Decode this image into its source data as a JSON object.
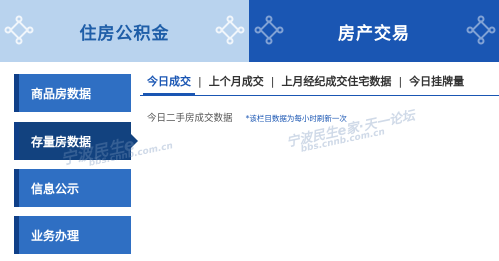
{
  "top_tabs": {
    "left_label": "住房公积金",
    "right_label": "房产交易"
  },
  "sidebar": {
    "items": [
      {
        "label": "商品房数据"
      },
      {
        "label": "存量房数据"
      },
      {
        "label": "信息公示"
      },
      {
        "label": "业务办理"
      }
    ]
  },
  "subtabs": {
    "items": [
      {
        "label": "今日成交"
      },
      {
        "label": "上个月成交"
      },
      {
        "label": "上月经纪成交住宅数据"
      },
      {
        "label": "今日挂牌量"
      }
    ],
    "separator": "|"
  },
  "info": {
    "label": "今日二手房成交数据",
    "note": "*该栏目数据为每小时刷新一次"
  },
  "watermarks": {
    "w1": "宁波民生e",
    "w2": "bbs.cnnb.com.cn",
    "w3": "宁波民生e家·天一论坛",
    "w4": "bbs.cnnb.com.cn"
  },
  "colors": {
    "accent": "#1a56b3",
    "light_tab": "#b9d3ee",
    "sidebar_button": "#2f6fc3",
    "sidebar_active": "#12427f"
  }
}
